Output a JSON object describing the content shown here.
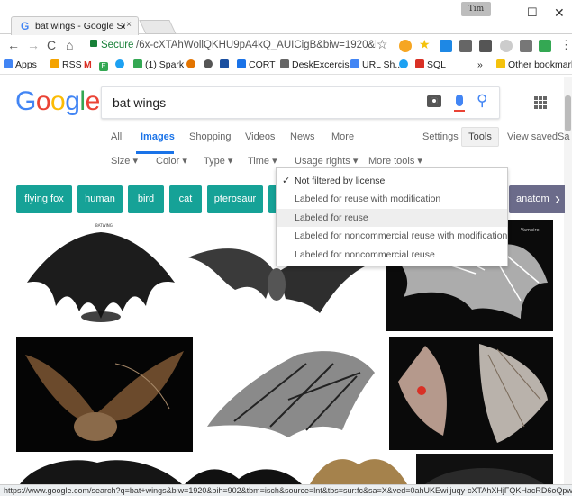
{
  "browser": {
    "tab_title": "bat wings - Google Sear",
    "tab_close": "×",
    "user_badge": "Tim",
    "secure_label": "Secure",
    "url": "/6x-cXTAhWollQKHU9pA4kQ_AUICigB&biw=1920&bih=902",
    "bookmarks": [
      "Apps",
      "RSS",
      "M",
      "E",
      "(1) Spark",
      "CORT",
      "DeskExcercise",
      "URL Sh...",
      "SQL"
    ],
    "bookmarks_overflow": "»",
    "other_bookmarks": "Other bookmarks",
    "status_url": "https://www.google.com/search?q=bat+wings&biw=1920&bih=902&tbm=isch&source=lnt&tbs=sur:fc&sa=X&ved=0ahUKEwiljuqy-cXTAhXHjFQKHacRD6oQpwU..."
  },
  "google": {
    "logo": "Google",
    "query": "bat wings",
    "nav_tabs": [
      "All",
      "Images",
      "Shopping",
      "Videos",
      "News",
      "More"
    ],
    "settings": "Settings",
    "tools": "Tools",
    "view_saved": "View saved",
    "safe": "Sa",
    "tools_row": [
      "Size",
      "Color",
      "Type",
      "Time",
      "Usage rights",
      "More tools"
    ],
    "chips": [
      "flying fox",
      "human",
      "bird",
      "cat",
      "pterosaur",
      "anatom"
    ],
    "usage_rights_menu": [
      "Not filtered by license",
      "Labeled for reuse with modification",
      "Labeled for reuse",
      "Labeled for noncommercial reuse with modification",
      "Labeled for noncommercial reuse"
    ],
    "selected_option": "Not filtered by license",
    "image_texts": {
      "img1_label": "BATWING",
      "img3_label": "Vampire"
    }
  },
  "colors": {
    "chip_bg": "#16a297",
    "link_blue": "#1a73e8",
    "logo": [
      "#4285f4",
      "#ea4335",
      "#fbbc05",
      "#4285f4",
      "#34a853",
      "#ea4335"
    ]
  }
}
